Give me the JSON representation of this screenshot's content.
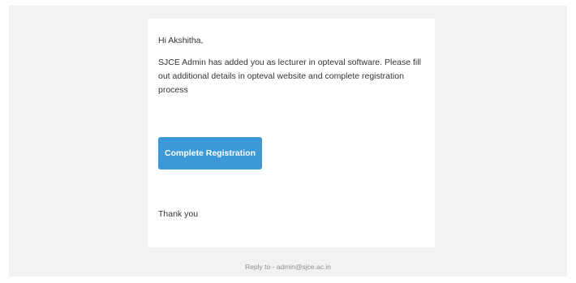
{
  "email": {
    "greeting": "Hi Akshitha,",
    "message": "SJCE Admin has added you as lecturer in opteval software. Please fill out additional details in opteval website and complete registration process",
    "button_label": "Complete Registration",
    "closing": "Thank you",
    "footer": "Reply to - admin@sjce.ac.in"
  },
  "colors": {
    "background": "#f2f2f2",
    "card": "#ffffff",
    "button": "#3b98d9",
    "text": "#333333",
    "footer_text": "#8f8f8f"
  }
}
